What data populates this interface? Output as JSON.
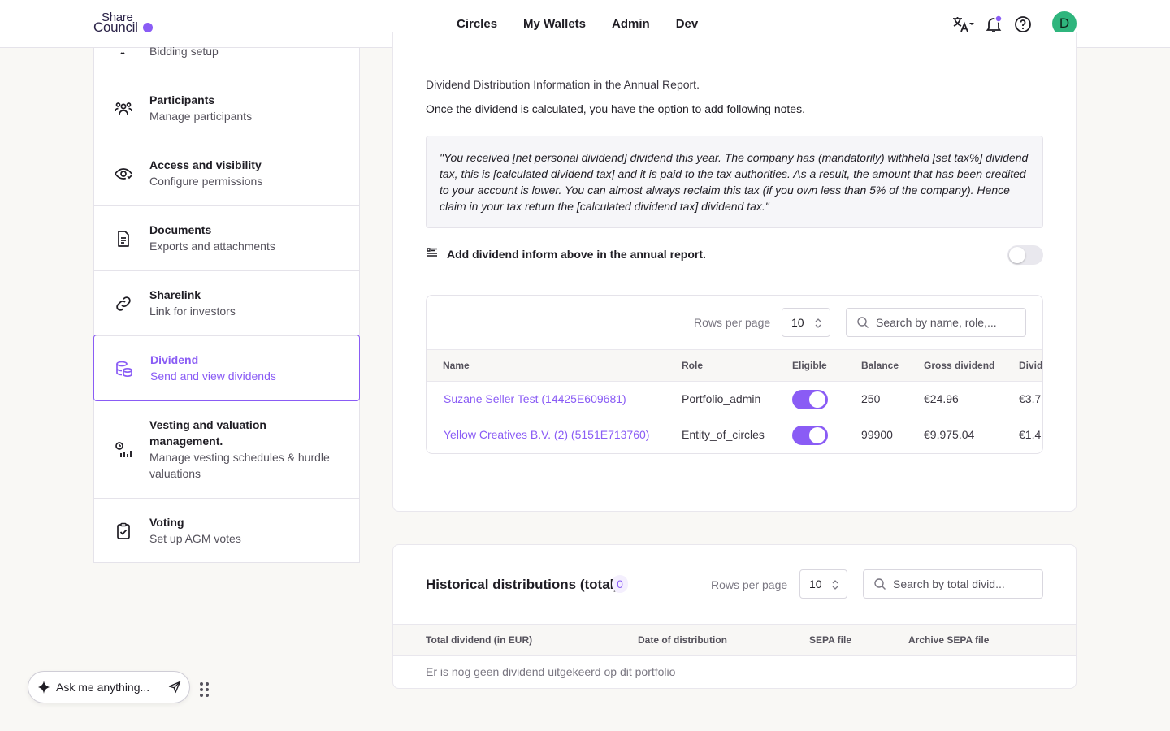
{
  "header": {
    "logo_line1": "Share",
    "logo_line2": "Council",
    "nav": [
      "Circles",
      "My Wallets",
      "Admin",
      "Dev"
    ],
    "avatar_initial": "D",
    "icons": [
      "translate-icon",
      "bell-icon",
      "help-icon"
    ]
  },
  "sidebar": {
    "items": [
      {
        "title": "",
        "subtitle": "Bidding setup",
        "icon": "bidding-icon"
      },
      {
        "title": "Participants",
        "subtitle": "Manage participants",
        "icon": "people-icon"
      },
      {
        "title": "Access and visibility",
        "subtitle": "Configure permissions",
        "icon": "eye-icon"
      },
      {
        "title": "Documents",
        "subtitle": "Exports and attachments",
        "icon": "document-icon"
      },
      {
        "title": "Sharelink",
        "subtitle": "Link for investors",
        "icon": "link-icon"
      },
      {
        "title": "Dividend",
        "subtitle": "Send and view dividends",
        "icon": "coins-icon",
        "active": true
      },
      {
        "title": "Vesting and valuation management.",
        "subtitle": "Manage vesting schedules & hurdle valuations",
        "icon": "vesting-chart-icon"
      },
      {
        "title": "Voting",
        "subtitle": "Set up AGM votes",
        "icon": "clipboard-check-icon"
      }
    ]
  },
  "dividend": {
    "info_title": "Dividend Distribution Information in the Annual Report.",
    "info_text": "Once the dividend is calculated, you have the option to add following notes.",
    "quote": "\"You received [net personal dividend] dividend this year. The company has (mandatorily) withheld [set tax%] dividend tax, this is [calculated dividend tax] and it is paid to the tax authorities. As a result, the amount that has been credited to your account is lower. You can almost always reclaim this tax (if you own less than 5% of the company). Hence claim in your tax return the [calculated dividend tax] dividend tax.\"",
    "add_label": "Add dividend inform above in the annual report.",
    "add_enabled": false,
    "table": {
      "rows_per_page_label": "Rows per page",
      "rows_per_page": "10",
      "search_placeholder": "Search by name, role,...",
      "columns": [
        "Name",
        "Role",
        "Eligible",
        "Balance",
        "Gross dividend",
        "Divid"
      ],
      "rows": [
        {
          "name": "Suzane Seller Test (14425E609681)",
          "role": "Portfolio_admin",
          "eligible": true,
          "balance": "250",
          "gross": "€24.96",
          "div": "€3.7"
        },
        {
          "name": "Yellow Creatives B.V. (2) (5151E713760)",
          "role": "Entity_of_circles",
          "eligible": true,
          "balance": "99900",
          "gross": "€9,975.04",
          "div": "€1,4"
        }
      ]
    }
  },
  "history": {
    "title": "Historical distributions (total)",
    "count": "0",
    "rows_per_page_label": "Rows per page",
    "rows_per_page": "10",
    "search_placeholder": "Search by total divid...",
    "columns": [
      "Total dividend (in EUR)",
      "Date of distribution",
      "SEPA file",
      "Archive SEPA file"
    ],
    "empty_text": "Er is nog geen dividend uitgekeerd op dit portfolio"
  },
  "chat": {
    "placeholder": "Ask me anything..."
  },
  "colors": {
    "accent": "#8a5cf5",
    "avatar": "#2fb57d",
    "background": "#f9f8f5"
  }
}
